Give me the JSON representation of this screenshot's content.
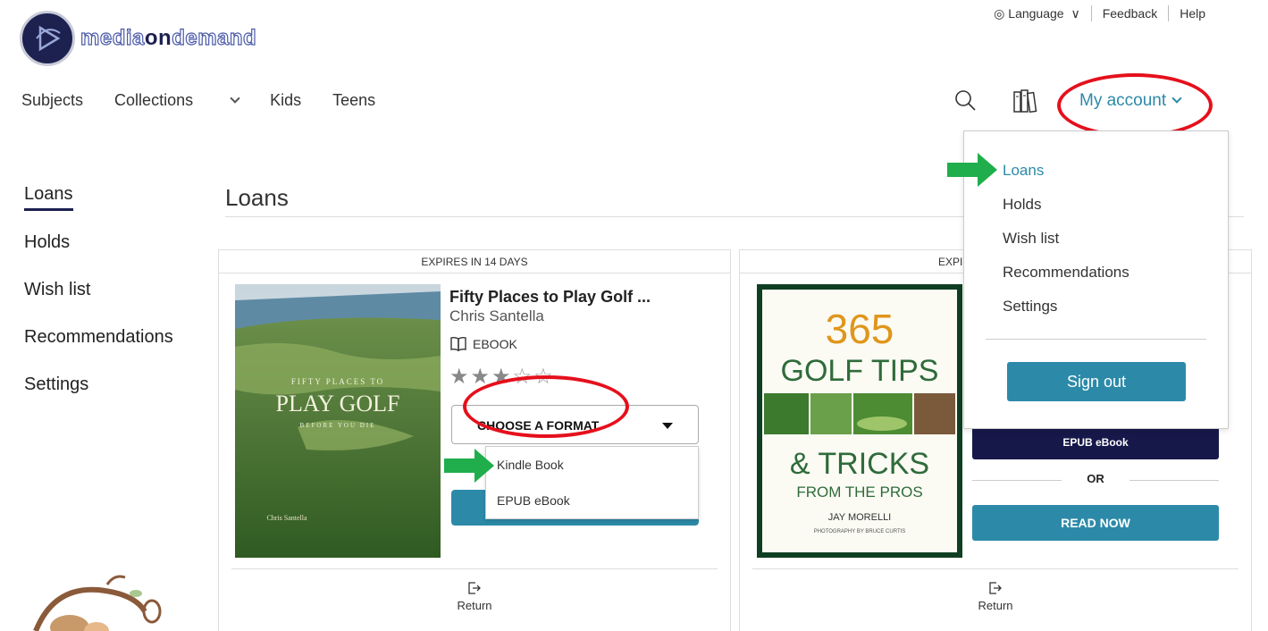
{
  "brand": {
    "logo_text_a": "media",
    "logo_text_b": "on",
    "logo_text_c": "demand"
  },
  "utility_nav": {
    "language": "Language",
    "feedback": "Feedback",
    "help": "Help"
  },
  "main_nav": {
    "subjects": "Subjects",
    "collections": "Collections",
    "kids": "Kids",
    "teens": "Teens",
    "my_account": "My account"
  },
  "sidebar": {
    "items": [
      {
        "label": "Loans"
      },
      {
        "label": "Holds"
      },
      {
        "label": "Wish list"
      },
      {
        "label": "Recommendations"
      },
      {
        "label": "Settings"
      }
    ]
  },
  "page": {
    "title": "Loans"
  },
  "cards": [
    {
      "expires": "EXPIRES IN 14 DAYS",
      "title": "Fifty Places to Play Golf ...",
      "author": "Chris Santella",
      "format": "EBOOK",
      "rating": 3,
      "rating_max": 5,
      "format_select": "CHOOSE A FORMAT",
      "format_options": [
        "Kindle Book",
        "EPUB eBook"
      ],
      "cover": {
        "line1": "FIFTY PLACES TO",
        "line2": "PLAY GOLF",
        "line3": "BEFORE YOU DIE",
        "author": "Chris Santella"
      },
      "return_label": "Return"
    },
    {
      "expires": "EXPI",
      "cover": {
        "line1": "365",
        "line2": "GOLF TIPS",
        "line3": "& TRICKS",
        "line4": "FROM THE PROS",
        "line5": "JAY MORELLI",
        "line6": "PHOTOGRAPHY BY BRUCE CURTIS"
      },
      "epub_button": "EPUB eBook",
      "or_label": "OR",
      "read_now": "READ NOW",
      "return_label": "Return"
    }
  ],
  "account_menu": {
    "items": [
      {
        "label": "Loans"
      },
      {
        "label": "Holds"
      },
      {
        "label": "Wish list"
      },
      {
        "label": "Recommendations"
      },
      {
        "label": "Settings"
      }
    ],
    "sign_out": "Sign out"
  },
  "colors": {
    "accent": "#2c8aa8",
    "navy": "#1d2150",
    "dark_button": "#17184a",
    "annotation_red": "#e5101c",
    "annotation_green": "#1fae4b"
  }
}
